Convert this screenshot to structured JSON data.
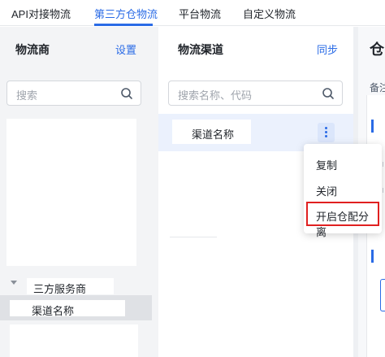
{
  "tabs": [
    {
      "label": "API对接物流"
    },
    {
      "label": "第三方仓物流"
    },
    {
      "label": "平台物流"
    },
    {
      "label": "自定义物流"
    }
  ],
  "left_panel": {
    "title": "物流商",
    "settings_label": "设置",
    "search_placeholder": "搜索",
    "tree_parent_label": "三方服务商",
    "tree_selected_label": "渠道名称"
  },
  "middle_panel": {
    "title": "物流渠道",
    "sync_label": "同步",
    "search_placeholder": "搜索名称、代码",
    "channel_name": "渠道名称"
  },
  "menu": {
    "items": [
      {
        "label": "复制"
      },
      {
        "label": "关闭"
      },
      {
        "label": "开启仓配分离"
      }
    ]
  },
  "right_panel": {
    "title": "仓",
    "note": "备注"
  },
  "colors": {
    "accent": "#2a6be6",
    "highlight_border": "#e02020",
    "panel_bg": "#f3f4f6"
  },
  "icons": {
    "search": "search-icon",
    "more": "more-vertical-icon",
    "caret": "caret-down-icon"
  }
}
